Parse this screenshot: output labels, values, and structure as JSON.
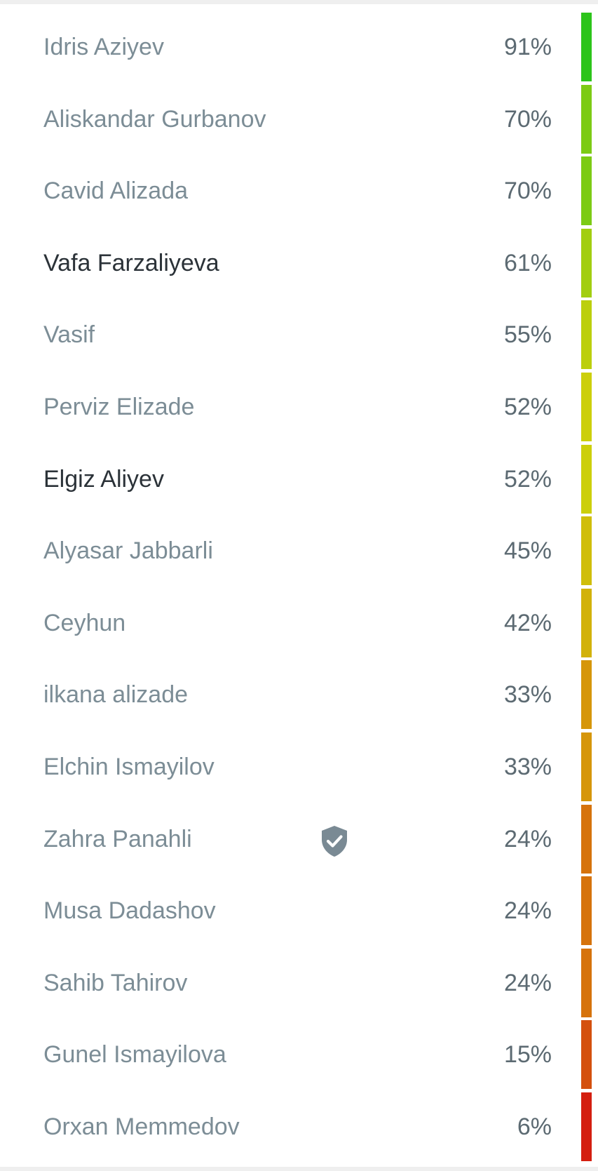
{
  "results": [
    {
      "name": "Idris Aziyev",
      "percent": "91%",
      "bar_color": "#2cc41a",
      "highlight": false,
      "badge": false
    },
    {
      "name": "Aliskandar Gurbanov",
      "percent": "70%",
      "bar_color": "#7ccb14",
      "highlight": false,
      "badge": false
    },
    {
      "name": "Cavid Alizada",
      "percent": "70%",
      "bar_color": "#7ccb14",
      "highlight": false,
      "badge": false
    },
    {
      "name": "Vafa Farzaliyeva",
      "percent": "61%",
      "bar_color": "#a2ce10",
      "highlight": true,
      "badge": false
    },
    {
      "name": "Vasif",
      "percent": "55%",
      "bar_color": "#bccf0d",
      "highlight": false,
      "badge": false
    },
    {
      "name": "Perviz Elizade",
      "percent": "52%",
      "bar_color": "#cccf0b",
      "highlight": false,
      "badge": false
    },
    {
      "name": "Elgiz Aliyev",
      "percent": "52%",
      "bar_color": "#cccf0b",
      "highlight": true,
      "badge": false
    },
    {
      "name": "Alyasar Jabbarli",
      "percent": "45%",
      "bar_color": "#d0be0a",
      "highlight": false,
      "badge": false
    },
    {
      "name": "Ceyhun",
      "percent": "42%",
      "bar_color": "#d2b20a",
      "highlight": false,
      "badge": false
    },
    {
      "name": "ilkana alizade",
      "percent": "33%",
      "bar_color": "#d6960a",
      "highlight": false,
      "badge": false
    },
    {
      "name": "Elchin Ismayilov",
      "percent": "33%",
      "bar_color": "#d6960a",
      "highlight": false,
      "badge": false
    },
    {
      "name": "Zahra Panahli",
      "percent": "24%",
      "bar_color": "#d6730c",
      "highlight": false,
      "badge": true,
      "badge_icon": "verified-shield-icon"
    },
    {
      "name": "Musa Dadashov",
      "percent": "24%",
      "bar_color": "#d6730c",
      "highlight": false,
      "badge": false
    },
    {
      "name": "Sahib Tahirov",
      "percent": "24%",
      "bar_color": "#d6730c",
      "highlight": false,
      "badge": false
    },
    {
      "name": "Gunel Ismayilova",
      "percent": "15%",
      "bar_color": "#d4500e",
      "highlight": false,
      "badge": false
    },
    {
      "name": "Orxan Memmedov",
      "percent": "6%",
      "bar_color": "#d41f10",
      "highlight": false,
      "badge": false
    }
  ],
  "colors": {
    "name_text": "#7c8d96",
    "name_text_highlight": "#2b3238",
    "percent_text": "#5c6a72",
    "badge": "#7a8a94",
    "background": "#ffffff",
    "page_background": "#efefef"
  }
}
